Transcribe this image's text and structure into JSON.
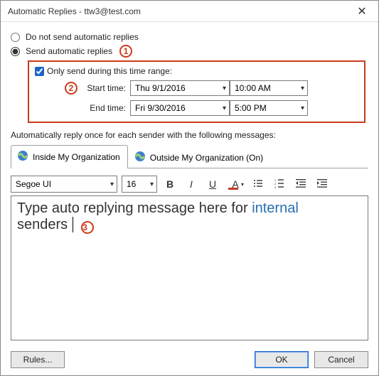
{
  "window": {
    "title": "Automatic Replies - ttw3@test.com"
  },
  "radios": {
    "do_not_send": "Do not send automatic replies",
    "send": "Send automatic replies"
  },
  "callouts": {
    "c1": "1",
    "c2": "2",
    "c3": "3"
  },
  "timerange": {
    "only_send": "Only send during this time range:",
    "start_label": "Start time:",
    "end_label": "End time:",
    "start_date": "Thu 9/1/2016",
    "start_time": "10:00 AM",
    "end_date": "Fri 9/30/2016",
    "end_time": "5:00 PM"
  },
  "instruction": "Automatically reply once for each sender with the following messages:",
  "tabs": {
    "inside": "Inside My Organization",
    "outside": "Outside My Organization (On)"
  },
  "toolbar": {
    "font_name": "Segoe UI",
    "font_size": "16",
    "bold": "B",
    "italic": "I",
    "underline": "U",
    "fontcolor": "A"
  },
  "editor": {
    "part1": "Type auto replying message here for ",
    "link": "internal",
    "part2": "senders"
  },
  "footer": {
    "rules": "Rules...",
    "ok": "OK",
    "cancel": "Cancel"
  }
}
